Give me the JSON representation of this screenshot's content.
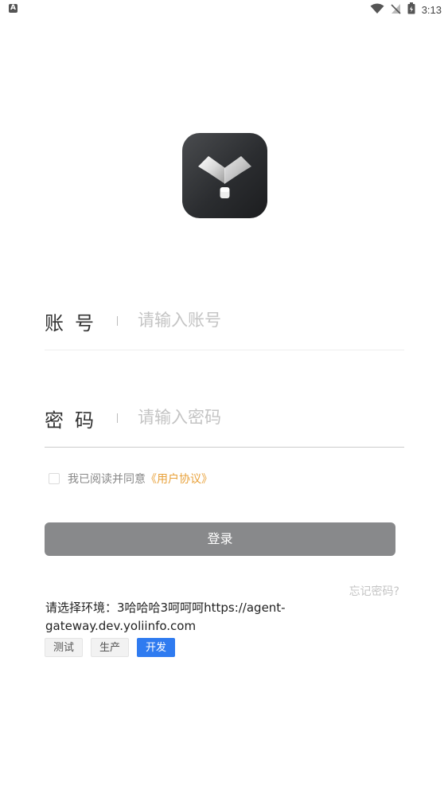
{
  "status_bar": {
    "notification_glyph": "A",
    "icons": [
      "wifi-icon",
      "no-signal-icon",
      "battery-icon"
    ],
    "time": "3:13"
  },
  "logo": {
    "icon": "app-logo"
  },
  "account": {
    "label": "账号",
    "placeholder": "请输入账号",
    "value": ""
  },
  "password": {
    "label": "密码",
    "placeholder": "请输入密码",
    "value": ""
  },
  "agreement": {
    "checked": false,
    "text": "我已阅读并同意",
    "link": "《用户协议》"
  },
  "login": {
    "label": "登录"
  },
  "forgot": {
    "label": "忘记密码?"
  },
  "environment": {
    "prompt": "请选择环境：3哈哈哈3呵呵呵https://agent-gateway.dev.yoliinfo.com",
    "options": [
      {
        "label": "测试",
        "selected": false
      },
      {
        "label": "生产",
        "selected": false
      },
      {
        "label": "开发",
        "selected": true
      }
    ]
  },
  "colors": {
    "accent": "#2f7bf0",
    "link": "#e8a13a",
    "button_disabled": "#88898b",
    "placeholder": "#c4c4c4"
  }
}
